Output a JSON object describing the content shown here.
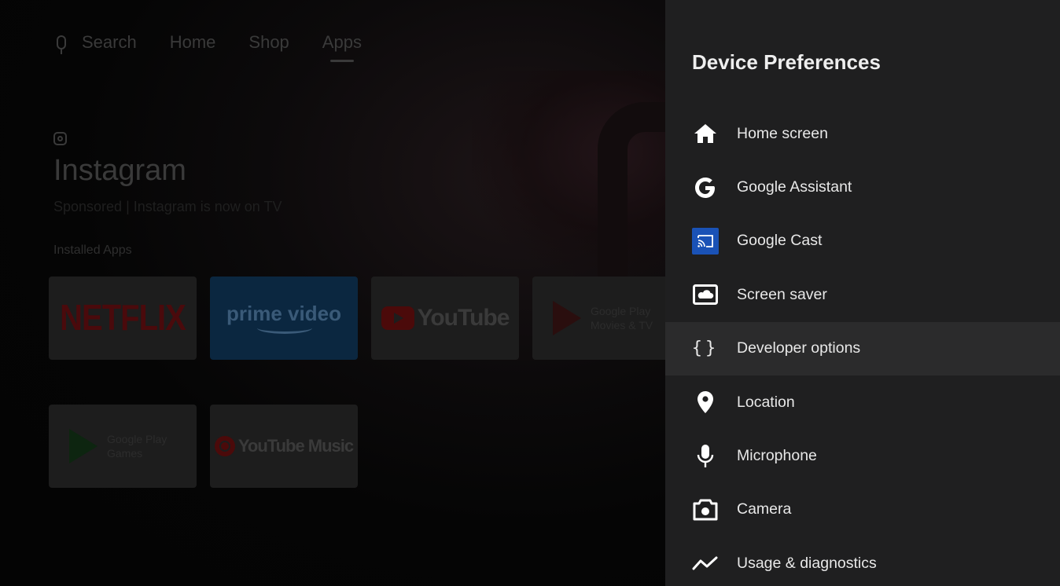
{
  "top_nav": {
    "search_label": "Search",
    "home_label": "Home",
    "shop_label": "Shop",
    "apps_label": "Apps",
    "active_tab": "Apps"
  },
  "featured": {
    "app_icon": "instagram-icon",
    "title": "Instagram",
    "subtitle": "Sponsored | Instagram is now on TV"
  },
  "installed_apps": {
    "section_label": "Installed Apps",
    "apps": [
      {
        "name": "Netflix",
        "logo_text": "NETFLIX"
      },
      {
        "name": "Prime Video",
        "logo_text": "prime video"
      },
      {
        "name": "YouTube",
        "logo_text": "YouTube"
      },
      {
        "name": "Google Play Movies & TV",
        "logo_line1": "Google Play",
        "logo_line2": "Movies & TV"
      },
      {
        "name": "Google Play Games",
        "logo_line1": "Google Play",
        "logo_line2": "Games"
      },
      {
        "name": "YouTube Music",
        "logo_text": "YouTube Music"
      }
    ]
  },
  "device_preferences": {
    "title": "Device Preferences",
    "focused_item": "Developer options",
    "items": [
      {
        "label": "Home screen",
        "icon": "home-icon"
      },
      {
        "label": "Google Assistant",
        "icon": "google-g-icon"
      },
      {
        "label": "Google Cast",
        "icon": "cast-icon",
        "icon_bg": "#1a52b6"
      },
      {
        "label": "Screen saver",
        "icon": "screensaver-icon"
      },
      {
        "label": "Developer options",
        "icon": "braces-icon"
      },
      {
        "label": "Location",
        "icon": "location-pin-icon"
      },
      {
        "label": "Microphone",
        "icon": "microphone-icon"
      },
      {
        "label": "Camera",
        "icon": "camera-icon"
      },
      {
        "label": "Usage & diagnostics",
        "icon": "usage-graph-icon"
      }
    ]
  },
  "colors": {
    "panel_bg": "#1f1f20",
    "focused_row_bg": "#2b2b2c",
    "text": "#e8e8e8",
    "cast_blue": "#1a52b6"
  }
}
